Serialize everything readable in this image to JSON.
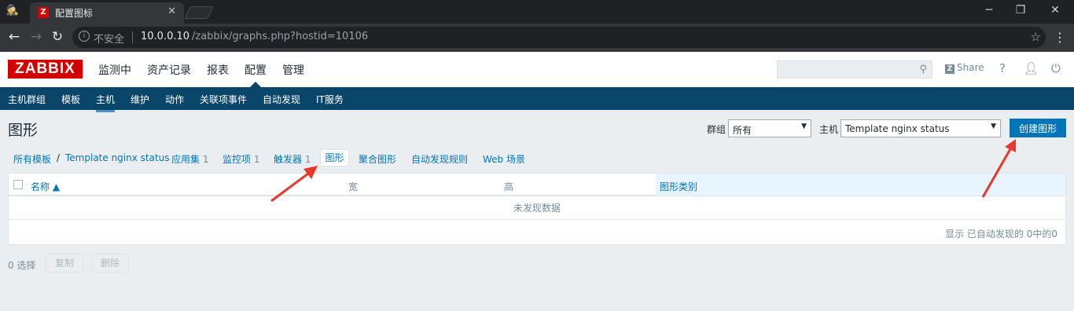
{
  "browser": {
    "tab_title": "配置图标",
    "tab_favicon": "Z",
    "insecure_label": "不安全",
    "url_host": "10.0.0.10",
    "url_path": "/zabbix/graphs.php?hostid=10106",
    "icons": [
      "incognito-icon",
      "back-icon",
      "forward-icon",
      "reload-icon",
      "info-icon",
      "star-icon",
      "menu-icon",
      "minimize-icon",
      "maximize-icon",
      "close-icon"
    ]
  },
  "header": {
    "logo": "ZABBIX",
    "menu": [
      "监测中",
      "资产记录",
      "报表",
      "配置",
      "管理"
    ],
    "active_menu": "配置",
    "share_label": "Share",
    "help_label": "?"
  },
  "subnav": {
    "items": [
      "主机群组",
      "模板",
      "主机",
      "维护",
      "动作",
      "关联项事件",
      "自动发现",
      "IT服务"
    ],
    "active": "主机"
  },
  "page": {
    "title": "图形",
    "group_label": "群组",
    "group_value": "所有",
    "host_label": "主机",
    "host_value": "Template nginx status",
    "create_button": "创建图形"
  },
  "breadcrumbs": {
    "all_templates": "所有模板",
    "separator": "/",
    "template": "Template nginx status",
    "apps": "应用集",
    "apps_count": "1",
    "items": "监控项",
    "items_count": "1",
    "triggers": "触发器",
    "triggers_count": "1",
    "graphs": "图形",
    "screens": "聚合图形",
    "discovery": "自动发现规则",
    "web": "Web 场景"
  },
  "table": {
    "columns": [
      "名称 ▲",
      "宽",
      "高",
      "图形类别"
    ],
    "empty_text": "未发现数据",
    "footer": "显示 已自动发现的 0中的0"
  },
  "actions": {
    "selected": "0 选择",
    "copy": "复制",
    "delete": "删除"
  },
  "colors": {
    "brand": "#d40000",
    "nav": "#0a466a",
    "link": "#0275b8",
    "annotation_arrow": "#e8372b"
  }
}
